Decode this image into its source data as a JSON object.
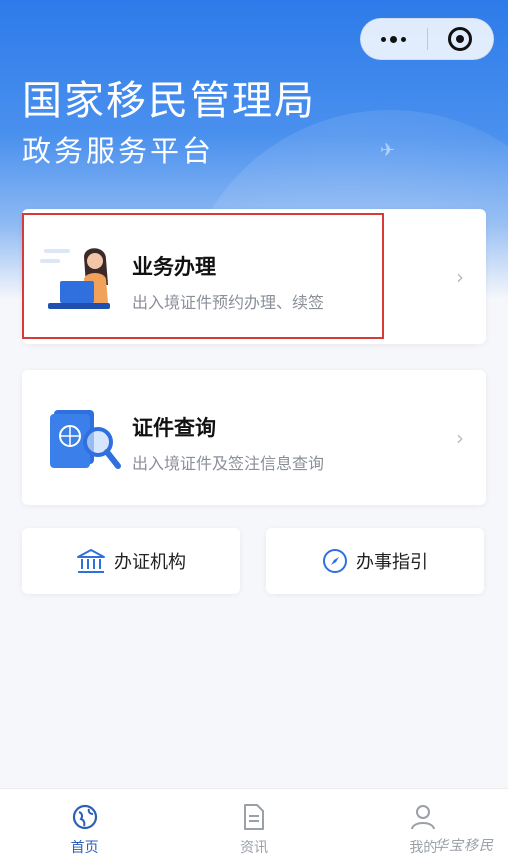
{
  "header": {
    "title": "国家移民管理局",
    "subtitle": "政务服务平台"
  },
  "capsule": {
    "more_icon": "more-dots-icon",
    "close_icon": "target-circle-icon"
  },
  "cards": [
    {
      "title": "业务办理",
      "desc": "出入境证件预约办理、续签",
      "icon": "person-laptop-illustration"
    },
    {
      "title": "证件查询",
      "desc": "出入境证件及签注信息查询",
      "icon": "passport-magnifier-illustration"
    }
  ],
  "quick_links": [
    {
      "label": "办证机构",
      "icon": "bank-building-icon"
    },
    {
      "label": "办事指引",
      "icon": "compass-icon"
    }
  ],
  "tabbar": {
    "items": [
      {
        "label": "首页",
        "icon": "globe-icon",
        "active": true
      },
      {
        "label": "资讯",
        "icon": "document-icon",
        "active": false
      },
      {
        "label": "我的",
        "icon": "user-icon",
        "active": false
      }
    ]
  },
  "watermark": "华宝移民",
  "colors": {
    "primary": "#2d7bea",
    "highlight": "#d83a3a",
    "tab_active": "#2d5fb8"
  }
}
